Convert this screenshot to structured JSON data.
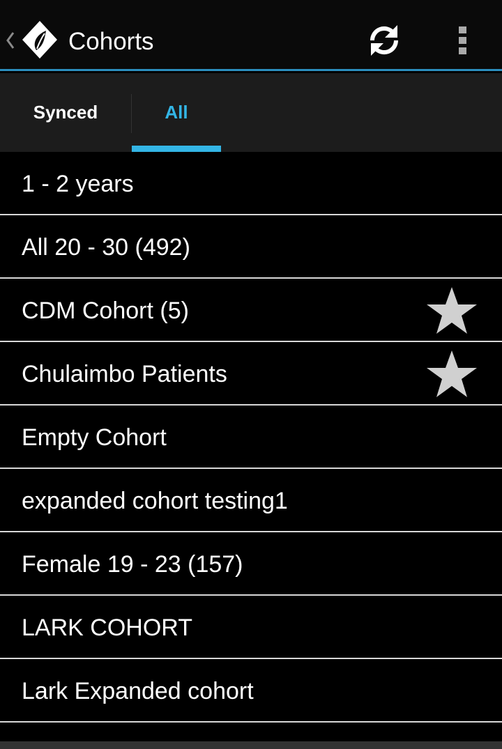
{
  "actionbar": {
    "title": "Cohorts",
    "up_icon": "chevron-left-icon",
    "logo_icon": "app-logo-icon",
    "refresh_icon": "refresh-icon",
    "overflow_icon": "overflow-menu-icon",
    "accent_color": "#2c8fbf"
  },
  "tabs": {
    "items": [
      {
        "label": "Synced",
        "selected": false
      },
      {
        "label": "All",
        "selected": true
      }
    ],
    "selected_color": "#33b5e5"
  },
  "cohorts": [
    {
      "name": "1 - 2 years",
      "starred": false
    },
    {
      "name": "All 20 - 30 (492)",
      "starred": false
    },
    {
      "name": "CDM Cohort (5)",
      "starred": true
    },
    {
      "name": "Chulaimbo Patients",
      "starred": true
    },
    {
      "name": "Empty Cohort",
      "starred": false
    },
    {
      "name": "expanded cohort testing1",
      "starred": false
    },
    {
      "name": "Female 19 - 23 (157)",
      "starred": false
    },
    {
      "name": "LARK COHORT",
      "starred": false
    },
    {
      "name": "Lark Expanded cohort",
      "starred": false
    }
  ],
  "star_icon": "star-icon",
  "star_color": "#d0d0d0"
}
